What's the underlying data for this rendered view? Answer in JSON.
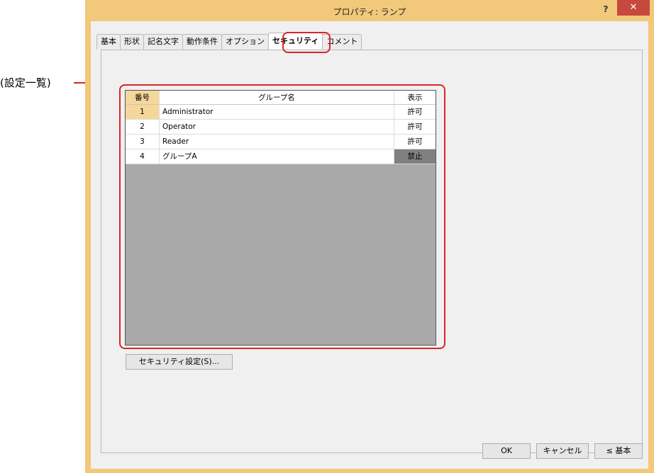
{
  "annotation": {
    "label": "(設定一覧)"
  },
  "window": {
    "title": "プロパティ: ランプ",
    "help_label": "?",
    "close_label": "✕"
  },
  "tabs": [
    {
      "label": "基本"
    },
    {
      "label": "形状"
    },
    {
      "label": "記名文字"
    },
    {
      "label": "動作条件"
    },
    {
      "label": "オプション"
    },
    {
      "label": "セキュリティ",
      "active": true
    },
    {
      "label": "コメント"
    }
  ],
  "table": {
    "headers": {
      "no": "番号",
      "name": "グループ名",
      "display": "表示"
    },
    "rows": [
      {
        "no": "1",
        "name": "Administrator",
        "display": "許可"
      },
      {
        "no": "2",
        "name": "Operator",
        "display": "許可"
      },
      {
        "no": "3",
        "name": "Reader",
        "display": "許可"
      },
      {
        "no": "4",
        "name": "グループA",
        "display": "禁止"
      }
    ]
  },
  "buttons": {
    "security_settings": "セキュリティ設定(S)...",
    "ok": "OK",
    "cancel": "キャンセル",
    "basic": "≤ 基本"
  },
  "colors": {
    "accent_highlight": "#d7262b",
    "titlebar": "#f2c87a",
    "close_button": "#c7483e",
    "selected_cell": "#f5d79a",
    "denied_cell": "#808080"
  }
}
